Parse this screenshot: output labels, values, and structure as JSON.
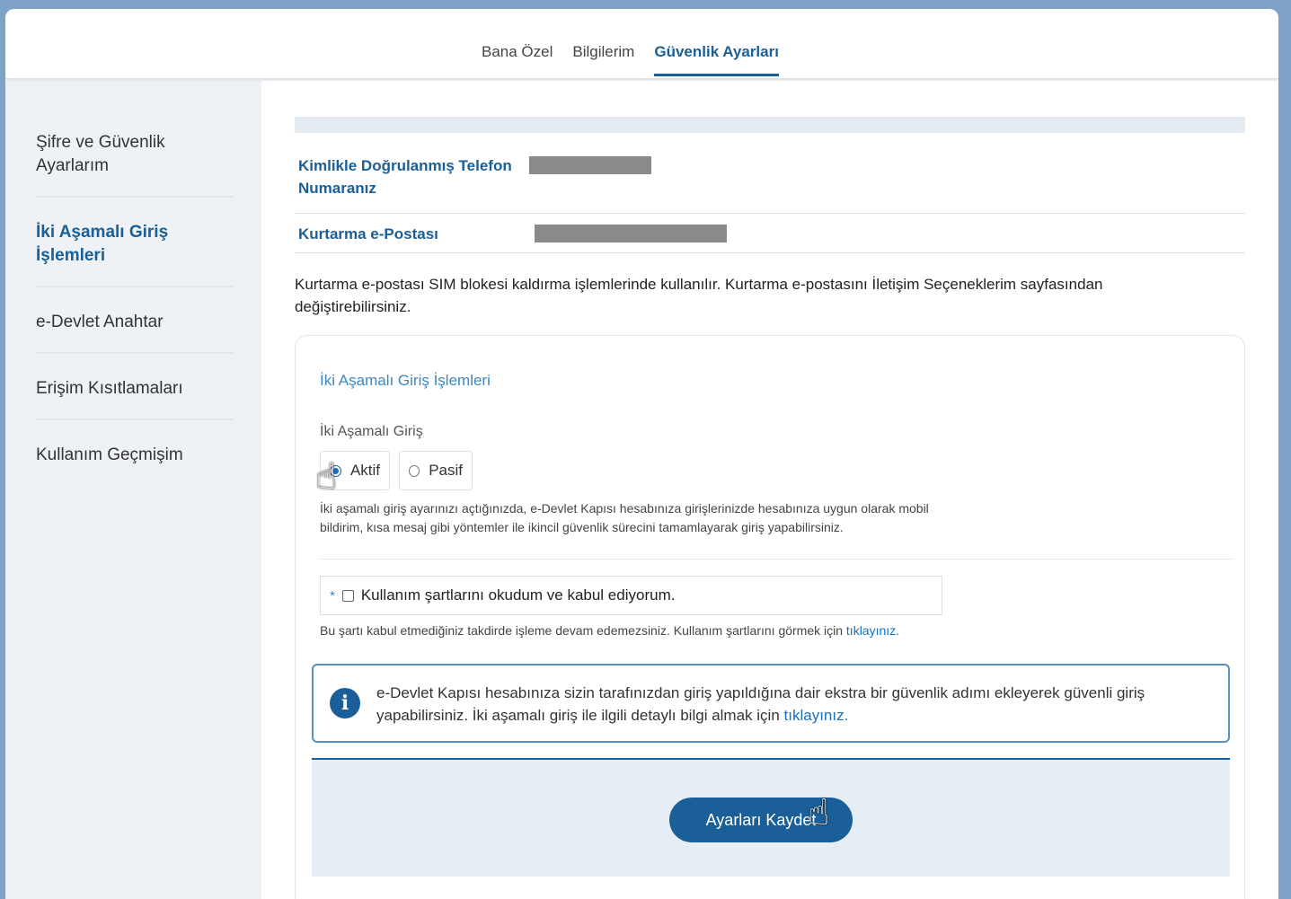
{
  "tabs": [
    {
      "label": "Bana Özel"
    },
    {
      "label": "Bilgilerim"
    },
    {
      "label": "Güvenlik Ayarları"
    }
  ],
  "sidebar": {
    "items": [
      {
        "label": "Şifre ve Güvenlik Ayarlarım"
      },
      {
        "label": "İki Aşamalı Giriş İşlemleri"
      },
      {
        "label": "e-Devlet Anahtar"
      },
      {
        "label": "Erişim Kısıtlamaları"
      },
      {
        "label": "Kullanım Geçmişim"
      }
    ]
  },
  "info": {
    "phone_label": "Kimlikle Doğrulanmış Telefon Numaranız",
    "email_label": "Kurtarma e-Postası",
    "note": "Kurtarma e-postası SIM blokesi kaldırma işlemlerinde kullanılır. Kurtarma e-postasını İletişim Seçeneklerim sayfasından değiştirebilirsiniz."
  },
  "card": {
    "title": "İki Aşamalı Giriş İşlemleri",
    "field_label": "İki Aşamalı Giriş",
    "option_active": "Aktif",
    "option_passive": "Pasif",
    "selected": "Aktif",
    "help": "İki aşamalı giriş ayarınızı açtığınızda, e-Devlet Kapısı hesabınıza girişlerinizde hesabınıza uygun olarak mobil bildirim, kısa mesaj gibi yöntemler ile ikincil güvenlik sürecini tamamlayarak giriş yapabilirsiniz.",
    "required_mark": "*",
    "terms_label": "Kullanım şartlarını okudum ve kabul ediyorum.",
    "terms_note": "Bu şartı kabul etmediğiniz takdirde işleme devam edemezsiniz. Kullanım şartlarını görmek için",
    "terms_link": "tıklayınız.",
    "alert_icon": "i",
    "alert_text": "e-Devlet Kapısı hesabınıza sizin tarafınızdan giriş yapıldığına dair ekstra bir güvenlik adımı ekleyerek güvenli giriş yapabilirsiniz. İki aşamalı giriş ile ilgili detaylı bilgi almak için",
    "alert_link": "tıklayınız.",
    "save_label": "Ayarları Kaydet"
  }
}
